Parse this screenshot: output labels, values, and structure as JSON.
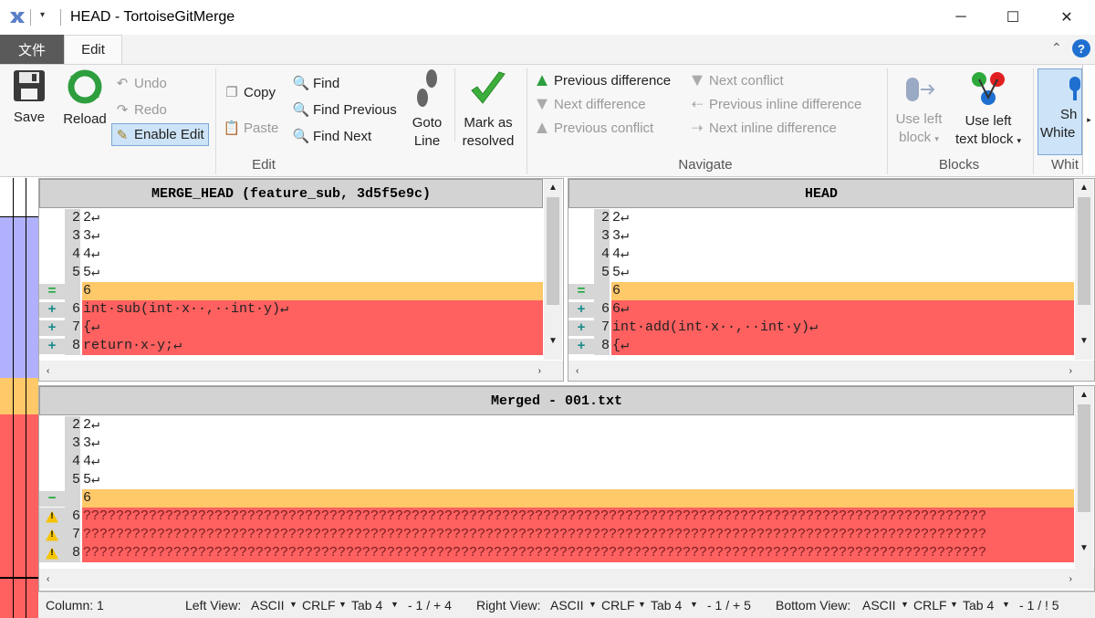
{
  "window": {
    "title": "HEAD - TortoiseGitMerge",
    "minimize_glyph": "─",
    "maximize_glyph": "☐",
    "close_glyph": "✕"
  },
  "tabs": {
    "file": "文件",
    "edit": "Edit"
  },
  "ribbon": {
    "save": "Save",
    "reload": "Reload",
    "undo": "Undo",
    "redo": "Redo",
    "enable_edit": "Enable Edit",
    "copy": "Copy",
    "paste": "Paste",
    "find": "Find",
    "find_previous": "Find Previous",
    "find_next": "Find Next",
    "goto_line_1": "Goto",
    "goto_line_2": "Line",
    "mark_resolved_1": "Mark as",
    "mark_resolved_2": "resolved",
    "group_edit": "Edit",
    "previous_difference": "Previous difference",
    "next_difference": "Next difference",
    "previous_conflict": "Previous conflict",
    "next_conflict": "Next conflict",
    "previous_inline_difference": "Previous inline difference",
    "next_inline_difference": "Next inline difference",
    "group_navigate": "Navigate",
    "use_left_block_1": "Use left",
    "use_left_block_2": "block",
    "use_left_text_block_1": "Use left",
    "use_left_text_block_2": "text block",
    "group_blocks": "Blocks",
    "show_whitespace_1": "Sh",
    "show_whitespace_2": "White",
    "group_whitespace": "Whit"
  },
  "left_pane": {
    "header": "MERGE_HEAD (feature_sub, 3d5f5e9c)",
    "lines": [
      {
        "marker": "",
        "num": "2",
        "text": "2↵",
        "state": "normal"
      },
      {
        "marker": "",
        "num": "3",
        "text": "3↵",
        "state": "normal"
      },
      {
        "marker": "",
        "num": "4",
        "text": "4↵",
        "state": "normal"
      },
      {
        "marker": "",
        "num": "5",
        "text": "5↵",
        "state": "normal"
      },
      {
        "marker": "=",
        "num": "",
        "text": "6",
        "state": "equal"
      },
      {
        "marker": "+",
        "num": "6",
        "text": "int·sub(int·x··,··int·y)↵",
        "state": "added"
      },
      {
        "marker": "+",
        "num": "7",
        "text": "{↵",
        "state": "added"
      },
      {
        "marker": "+",
        "num": "8",
        "text": "return·x-y;↵",
        "state": "added"
      }
    ]
  },
  "right_pane": {
    "header": "HEAD",
    "lines": [
      {
        "marker": "",
        "num": "2",
        "text": "2↵",
        "state": "normal"
      },
      {
        "marker": "",
        "num": "3",
        "text": "3↵",
        "state": "normal"
      },
      {
        "marker": "",
        "num": "4",
        "text": "4↵",
        "state": "normal"
      },
      {
        "marker": "",
        "num": "5",
        "text": "5↵",
        "state": "normal"
      },
      {
        "marker": "=",
        "num": "",
        "text": "6",
        "state": "equal"
      },
      {
        "marker": "+",
        "num": "6",
        "text": "6↵",
        "state": "added"
      },
      {
        "marker": "+",
        "num": "7",
        "text": "int·add(int·x··,··int·y)↵",
        "state": "added"
      },
      {
        "marker": "+",
        "num": "8",
        "text": "{↵",
        "state": "added"
      }
    ]
  },
  "bottom_pane": {
    "header": "Merged - 001.txt",
    "lines": [
      {
        "marker": "",
        "num": "2",
        "text": "2↵",
        "state": "normal"
      },
      {
        "marker": "",
        "num": "3",
        "text": "3↵",
        "state": "normal"
      },
      {
        "marker": "",
        "num": "4",
        "text": "4↵",
        "state": "normal"
      },
      {
        "marker": "",
        "num": "5",
        "text": "5↵",
        "state": "normal"
      },
      {
        "marker": "−",
        "num": "",
        "text": "6",
        "state": "equal"
      },
      {
        "marker": "!",
        "num": "6",
        "text": "??????????????????????????????????????????????????????????????????????????????????????????????????????????????",
        "state": "conflict"
      },
      {
        "marker": "!",
        "num": "7",
        "text": "??????????????????????????????????????????????????????????????????????????????????????????????????????????????",
        "state": "conflict"
      },
      {
        "marker": "!",
        "num": "8",
        "text": "??????????????????????????????????????????????????????????????????????????????????????????????????????????????",
        "state": "conflict"
      }
    ]
  },
  "status": {
    "column": "Column: 1",
    "left_view_label": "Left View:",
    "left_encoding": "ASCII",
    "left_eol": "CRLF",
    "left_tab": "Tab 4",
    "left_counts": "- 1 / + 4",
    "right_view_label": "Right View:",
    "right_encoding": "ASCII",
    "right_eol": "CRLF",
    "right_tab": "Tab 4",
    "right_counts": "- 1 / + 5",
    "bottom_view_label": "Bottom View:",
    "bottom_encoding": "ASCII",
    "bottom_eol": "CRLF",
    "bottom_tab": "Tab 4",
    "bottom_counts": "- 1 / ! 5"
  },
  "colors": {
    "added": "#ff6060",
    "equal": "#ffc868",
    "locator_blue": "#b0b0ff",
    "accent": "#1e6fd0"
  }
}
